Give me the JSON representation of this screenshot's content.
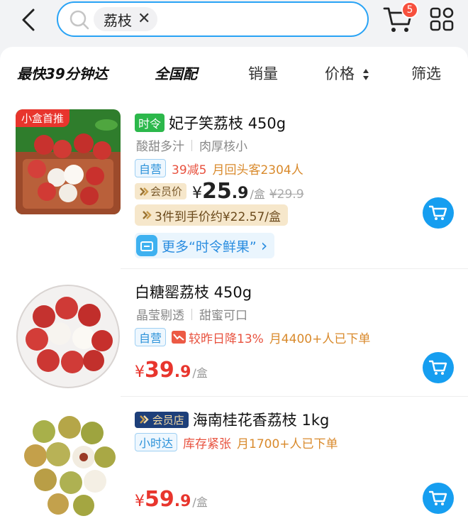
{
  "search": {
    "chip_text": "荔枝",
    "chip_close": "✕"
  },
  "header": {
    "cart_badge_count": "5"
  },
  "sort_bar": {
    "items": [
      "最快39分钟达",
      "全国配",
      "销量",
      "价格",
      "筛选"
    ]
  },
  "products": [
    {
      "image_tag": "小盒首推",
      "badge": "时令",
      "title": "妃子笑荔枝 450g",
      "desc": [
        "酸甜多汁",
        "肉厚核小"
      ],
      "tag_self": "自营",
      "promo": "39减5",
      "repeat_buyers": "月回头客2304人",
      "member_label": "会员价",
      "price_yen": "¥",
      "price_int": "25",
      "price_dec": ".9",
      "price_unit": "/盒",
      "price_orig": "¥29.9",
      "bundle": "3件到手价约¥22.57/盒",
      "more_link": "更多“时令鲜果”",
      "more_arrow": "›"
    },
    {
      "title": "白糖罂荔枝 450g",
      "desc": [
        "晶莹剔透",
        "甜蜜可口"
      ],
      "tag_self": "自营",
      "drop": "较昨日降13%",
      "orders": "月4400+人已下单",
      "price_yen": "¥",
      "price_int": "39",
      "price_dec": ".9",
      "price_unit": "/盒"
    },
    {
      "member_store": "会员店",
      "title": "海南桂花香荔枝 1kg",
      "tag_fast": "小时达",
      "stock": "库存紧张",
      "orders": "月1700+人已下单",
      "price_yen": "¥",
      "price_int": "59",
      "price_dec": ".9",
      "price_unit": "/盒"
    }
  ],
  "colors": {
    "accent_blue": "#169ef0",
    "price_red": "#e8352d",
    "badge_green": "#2cb84b"
  }
}
